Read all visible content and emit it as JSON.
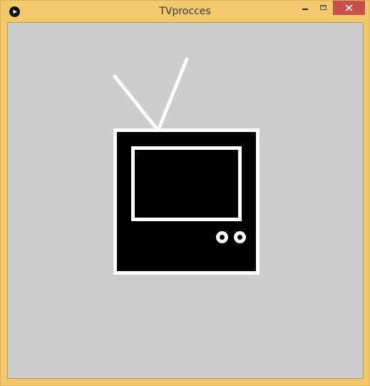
{
  "window": {
    "title": "TVprocces",
    "accent_color": "#f2c96a",
    "close_button_color": "#c7504a",
    "controls": [
      "minimize-icon",
      "maximize-icon",
      "close-icon"
    ]
  },
  "canvas": {
    "background_color": "#cdcdcd",
    "drawing": "television",
    "parts": [
      "left-antenna",
      "right-antenna",
      "tv-body",
      "tv-screen",
      "knob-left",
      "knob-right"
    ],
    "colors": {
      "tv_fill": "#000000",
      "tv_stroke": "#ffffff"
    }
  }
}
